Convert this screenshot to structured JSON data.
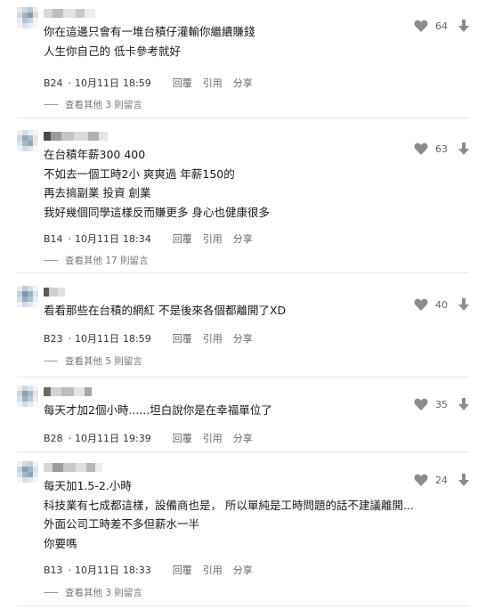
{
  "comments": [
    {
      "lines": [
        "你在這邊只會有一堆台積仔灌輸你繼續賺錢",
        "人生你自己的 低卡參考就好"
      ],
      "floor": "B24",
      "date": "10月11日",
      "time": "18:59",
      "reply_label": "回覆",
      "quote_label": "引用",
      "share_label": "分享",
      "replies_label": "查看其他 3 則留言",
      "likes": "64"
    },
    {
      "lines": [
        "在台積年薪300 400",
        "不如去一個工時2小 爽爽過 年薪150的",
        "再去搞副業 投資 創業",
        "我好幾個同學這樣反而賺更多 身心也健康很多"
      ],
      "floor": "B14",
      "date": "10月11日",
      "time": "18:34",
      "reply_label": "回覆",
      "quote_label": "引用",
      "share_label": "分享",
      "replies_label": "查看其他 17 則留言",
      "likes": "63"
    },
    {
      "lines": [
        "看看那些在台積的網紅 不是後來各個都離開了XD"
      ],
      "floor": "B23",
      "date": "10月11日",
      "time": "18:59",
      "reply_label": "回覆",
      "quote_label": "引用",
      "share_label": "分享",
      "replies_label": "查看其他 5 則留言",
      "likes": "40"
    },
    {
      "lines": [
        "每天才加2個小時......坦白說你是在幸福單位了"
      ],
      "floor": "B28",
      "date": "10月11日",
      "time": "19:39",
      "reply_label": "回覆",
      "quote_label": "引用",
      "share_label": "分享",
      "replies_label": "",
      "likes": "35"
    },
    {
      "lines": [
        "每天加1.5-2.小時",
        "科技業有七成都這樣，設備商也是， 所以單純是工時問題的話不建議離開...",
        "外面公司工時差不多但薪水一半",
        "你要嗎"
      ],
      "floor": "B13",
      "date": "10月11日",
      "time": "18:33",
      "reply_label": "回覆",
      "quote_label": "引用",
      "share_label": "分享",
      "replies_label": "查看其他 3 則留言",
      "likes": "24"
    }
  ],
  "icons": {
    "heart": "heart-icon",
    "downvote": "arrow-down-icon"
  },
  "colors": {
    "text": "#1a1a1a",
    "meta": "#666666",
    "icon": "#8c8c8c",
    "divider": "#e6e6e6"
  }
}
